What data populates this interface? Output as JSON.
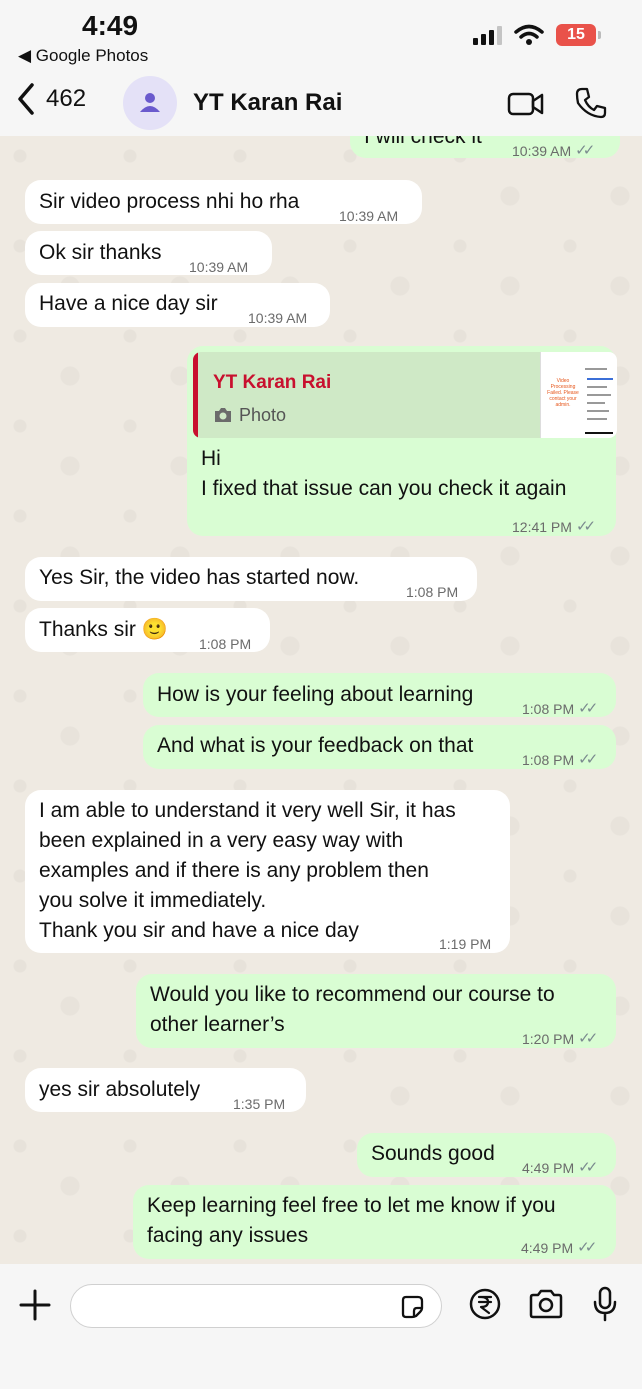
{
  "status_bar": {
    "time": "4:49",
    "back_app": "◀ Google Photos",
    "battery": "15"
  },
  "header": {
    "back_count": "462",
    "contact_name": "YT Karan Rai"
  },
  "messages": [
    {
      "dir": "out",
      "text": "I will check it",
      "time": "10:39 AM",
      "ticks": "✓✓"
    },
    {
      "dir": "in",
      "text": "Sir video process nhi ho rha",
      "time": "10:39 AM"
    },
    {
      "dir": "in",
      "text": "Ok sir thanks",
      "time": "10:39 AM"
    },
    {
      "dir": "in",
      "text": "Have a nice day sir",
      "time": "10:39 AM"
    },
    {
      "dir": "out",
      "quote_name": "YT Karan Rai",
      "quote_type": "Photo",
      "thumb_text": "Video Processing Failed. Please contact your admin.",
      "text": "Hi\nI fixed that issue can you check it again",
      "time": "12:41 PM",
      "ticks": "✓✓"
    },
    {
      "dir": "in",
      "text": "Yes Sir, the video has started now.",
      "time": "1:08 PM"
    },
    {
      "dir": "in",
      "text": "Thanks sir 🙂",
      "time": "1:08 PM"
    },
    {
      "dir": "out",
      "text": "How is your feeling about learning",
      "time": "1:08 PM",
      "ticks": "✓✓"
    },
    {
      "dir": "out",
      "text": "And what is your feedback on that",
      "time": "1:08 PM",
      "ticks": "✓✓"
    },
    {
      "dir": "in",
      "text": "I am able to understand it very well Sir, it has\nbeen explained in a very easy way with\nexamples and if there is any problem then\nyou solve it immediately.\nThank you sir and have a nice day",
      "time": "1:19 PM"
    },
    {
      "dir": "out",
      "text": "Would you like to recommend our course to\nother learner’s",
      "time": "1:20 PM",
      "ticks": "✓✓"
    },
    {
      "dir": "in",
      "text": "yes sir absolutely",
      "time": "1:35 PM"
    },
    {
      "dir": "out",
      "text": "Sounds good",
      "time": "4:49 PM",
      "ticks": "✓✓"
    },
    {
      "dir": "out",
      "text": "Keep learning feel free to let me know if you\nfacing any issues",
      "time": "4:49 PM",
      "ticks": "✓✓"
    }
  ],
  "input": {
    "placeholder": ""
  },
  "colors": {
    "incoming_bubble": "#ffffff",
    "outgoing_bubble": "#d9fdd3",
    "chat_background": "#efeae2",
    "quote_accent": "#c8102e"
  }
}
